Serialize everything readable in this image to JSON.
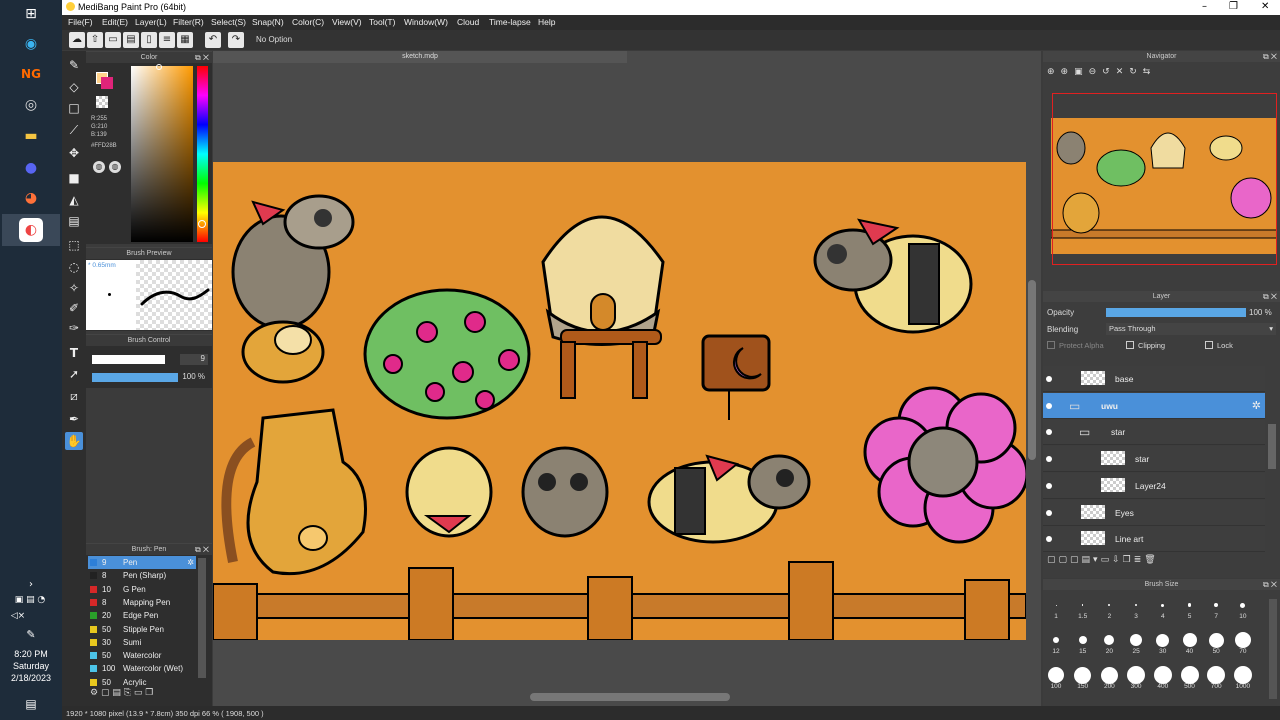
{
  "window": {
    "title": "MediBang Paint Pro (64bit)",
    "controls": [
      "–",
      "❐",
      "✕"
    ]
  },
  "menu": [
    "File(F)",
    "Edit(E)",
    "Layer(L)",
    "Filter(R)",
    "Select(S)",
    "Snap(N)",
    "Color(C)",
    "View(V)",
    "Tool(T)",
    "Window(W)",
    "Cloud",
    "Time-lapse",
    "Help"
  ],
  "toolbar": {
    "option_label": "No Option"
  },
  "document": {
    "tab_label": "sketch.mdp"
  },
  "color_panel": {
    "title": "Color",
    "rgb_r": "R:255",
    "rgb_g": "G:210",
    "rgb_b": "B:139",
    "hex": "#FFD28B",
    "fg_color": "#ffd28b",
    "bg_color": "#e0247a"
  },
  "brush_preview": {
    "title": "Brush Preview",
    "size_label": "* 0.65mm"
  },
  "brush_control": {
    "title": "Brush Control",
    "size": "9",
    "opacity": "100 %",
    "size_fraction": 0.85,
    "opacity_fraction": 1.0
  },
  "brush_list": {
    "title": "Brush: Pen",
    "items": [
      {
        "size": "9",
        "name": "Pen",
        "color": "#2d7fd8",
        "selected": true
      },
      {
        "size": "8",
        "name": "Pen (Sharp)",
        "color": "#222222"
      },
      {
        "size": "10",
        "name": "G Pen",
        "color": "#d62828"
      },
      {
        "size": "8",
        "name": "Mapping Pen",
        "color": "#d62828"
      },
      {
        "size": "20",
        "name": "Edge Pen",
        "color": "#2aa02a"
      },
      {
        "size": "50",
        "name": "Stipple Pen",
        "color": "#e8c81e"
      },
      {
        "size": "30",
        "name": "Sumi",
        "color": "#e8c81e"
      },
      {
        "size": "50",
        "name": "Watercolor",
        "color": "#4cc4e8"
      },
      {
        "size": "100",
        "name": "Watercolor (Wet)",
        "color": "#4cc4e8"
      },
      {
        "size": "50",
        "name": "Acrylic",
        "color": "#e8c81e"
      }
    ]
  },
  "navigator": {
    "title": "Navigator"
  },
  "layer_panel": {
    "title": "Layer",
    "opacity_label": "Opacity",
    "opacity_value": "100 %",
    "opacity_fraction": 1.0,
    "blending_label": "Blending",
    "blending_value": "Pass Through",
    "protect_alpha": "Protect Alpha",
    "clipping": "Clipping",
    "lock": "Lock",
    "layers": [
      {
        "name": "base",
        "type": "layer"
      },
      {
        "name": "uwu",
        "type": "folder",
        "selected": true
      },
      {
        "name": "star",
        "type": "folder"
      },
      {
        "name": "star",
        "type": "layer"
      },
      {
        "name": "Layer24",
        "type": "layer"
      },
      {
        "name": "Eyes",
        "type": "layer"
      },
      {
        "name": "Line art",
        "type": "layer"
      }
    ]
  },
  "brush_size_panel": {
    "title": "Brush Size",
    "sizes": [
      "1",
      "1.5",
      "2",
      "3",
      "4",
      "5",
      "7",
      "10",
      "12",
      "15",
      "20",
      "25",
      "30",
      "40",
      "50",
      "70",
      "100",
      "150",
      "200",
      "300",
      "400",
      "500",
      "700",
      "1000"
    ]
  },
  "status_bar": {
    "text": "1920 * 1080 pixel  (13.9 * 7.8cm)  350 dpi  66 %  ( 1908, 500 )"
  },
  "taskbar": {
    "time": "8:20 PM",
    "day": "Saturday",
    "date": "2/18/2023"
  }
}
